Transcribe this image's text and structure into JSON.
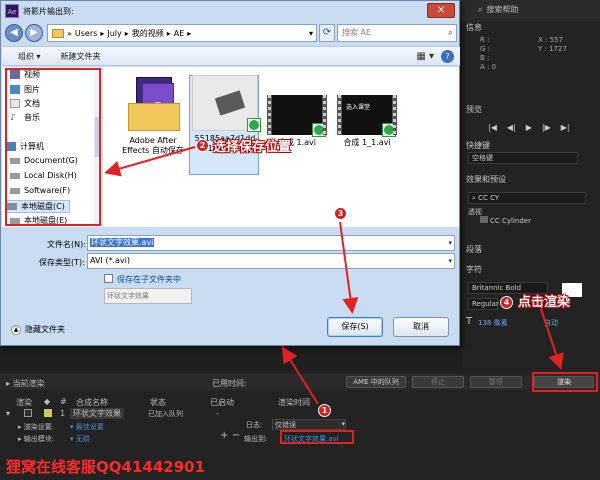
{
  "ae": {
    "search_help": "搜索帮助",
    "info_panel": "信息",
    "info_r": "R :",
    "info_g": "G :",
    "info_b": "B :",
    "info_a": "A : 0",
    "info_x": "X : 557",
    "info_y": "Y : 1727",
    "preview_panel": "预览",
    "shortcut_panel": "快捷键",
    "shortcut_value": "空格键",
    "effects_panel": "效果和预设",
    "effects_search": "CC CY",
    "effects_folder": "透视",
    "effects_item": "CC Cylinder",
    "paragraph_panel": "段落",
    "character_panel": "字符",
    "font_name": "Britannic Bold",
    "font_style": "Regular",
    "font_size": "138 像素",
    "tracking": "自动",
    "queue": {
      "current_render": "当前渲染",
      "elapsed": "已用时间:",
      "ame_button": "AME 中的队列",
      "stop_button": "停止",
      "pause_button": "暂停",
      "render_button": "渲染",
      "col_render": "渲染",
      "col_num": "#",
      "col_comp": "合成名称",
      "col_status": "状态",
      "col_started": "已启动",
      "col_render_time": "渲染时间",
      "row_num": "1",
      "row_comp": "环状文字效果",
      "row_status": "已加入队列",
      "row_started": "-",
      "render_settings_label": "渲染设置:",
      "render_settings_value": "最佳设置",
      "output_module_label": "输出模块:",
      "output_module_value": "无损",
      "log_label": "日志:",
      "log_value": "仅错误",
      "output_to_label": "输出到:",
      "output_to_value": "环状文字效果.avi"
    }
  },
  "dialog": {
    "title": "将影片输出到:",
    "close_glyph": "✕",
    "path": [
      "Users",
      "July",
      "我的视频",
      "AE"
    ],
    "search_placeholder": "搜索 AE",
    "toolbar_organize": "组织 ▾",
    "toolbar_new_folder": "新建文件夹",
    "nav": [
      "视频",
      "图片",
      "文档",
      "音乐",
      "计算机",
      "Document(G)",
      "Local Disk(H)",
      "Software(F)",
      "本地磁盘(C)",
      "本地磁盘(E)"
    ],
    "files": [
      {
        "name_line1": "Adobe After",
        "name_line2": "Effects 自动保存"
      },
      {
        "name_line1": "55185aa7d1dd",
        "name_line2": "a1d4a9.avi"
      },
      {
        "name_line1": "合成 1.avi",
        "name_line2": ""
      },
      {
        "name_line1": "合成 1_1.avi",
        "name_line2": ""
      }
    ],
    "video_text": "选入课堂",
    "filename_label": "文件名(N):",
    "filename_value": "环状文字效果.avi",
    "filetype_label": "保存类型(T):",
    "filetype_value": "AVI (*.avi)",
    "subfolder_label": "保存在子文件夹中",
    "subfolder_value": "环状文字效果",
    "hide_folders": "隐藏文件夹",
    "save_button": "保存(S)",
    "cancel_button": "取消"
  },
  "annotations": {
    "n1": "1",
    "n2": "2",
    "n3": "3",
    "n4": "4",
    "step2": "选择保存位置",
    "step4": "点击渲染",
    "watermark": "狸窝在线客服QQ41442901"
  }
}
